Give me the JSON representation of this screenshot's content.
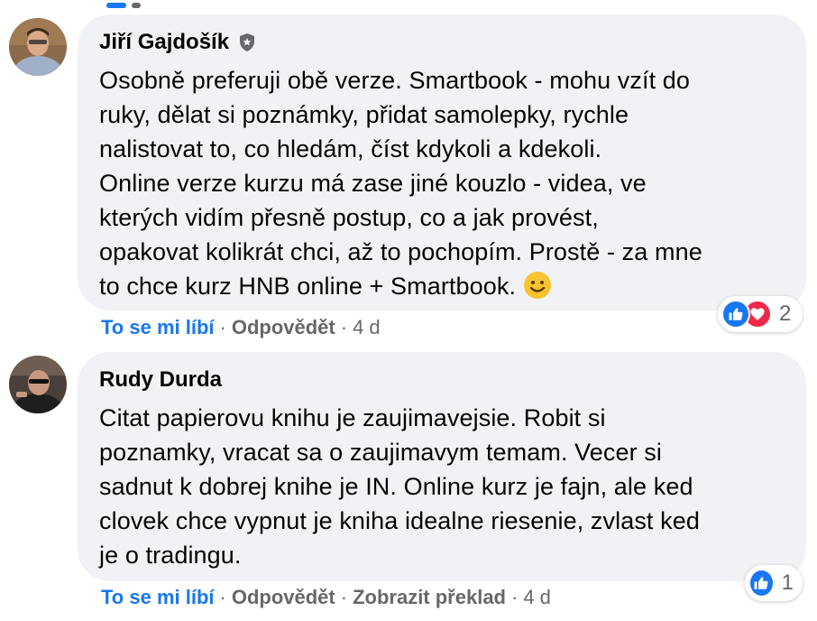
{
  "comments": [
    {
      "author": "Jiří Gajdošík",
      "badge_icon": "shield-badge-icon",
      "text": "Osobně preferuji obě verze. Smartbook - mohu vzít do\nruky, dělat si poznámky, přidat samolepky, rychle\nnalistovat to, co hledám, číst kdykoli a kdekoli.\nOnline verze kurzu má zase jiné kouzlo - videa, ve\nkterých vidím přesně postup, co a jak provést,\nopakovat kolikrát chci, až to pochopím. Prostě - za mne\nto chce kurz HNB online + Smartbook.",
      "emoji": "smiling-face",
      "actions": {
        "like": "To se mi líbí",
        "reply": "Odpovědět",
        "time": "4 d"
      },
      "reactions": {
        "types": [
          "like",
          "love"
        ],
        "count": "2"
      }
    },
    {
      "author": "Rudy Durda",
      "text": "Citat papierovu knihu je zaujimavejsie. Robit si\npoznamky, vracat sa o zaujimavym temam. Vecer si\nsadnut k dobrej knihe je IN. Online kurz je fajn, ale ked\nclovek chce vypnut je kniha idealne riesenie, zvlast ked\nje o tradingu.",
      "actions": {
        "like": "To se mi líbí",
        "reply": "Odpovědět",
        "translate": "Zobrazit překlad",
        "time": "4 d"
      },
      "reactions": {
        "types": [
          "like"
        ],
        "count": "1"
      }
    }
  ],
  "colors": {
    "link_blue": "#1877f2",
    "bubble_bg": "#f0f2f5",
    "meta_gray": "#65676b",
    "love_red": "#f0284a"
  }
}
